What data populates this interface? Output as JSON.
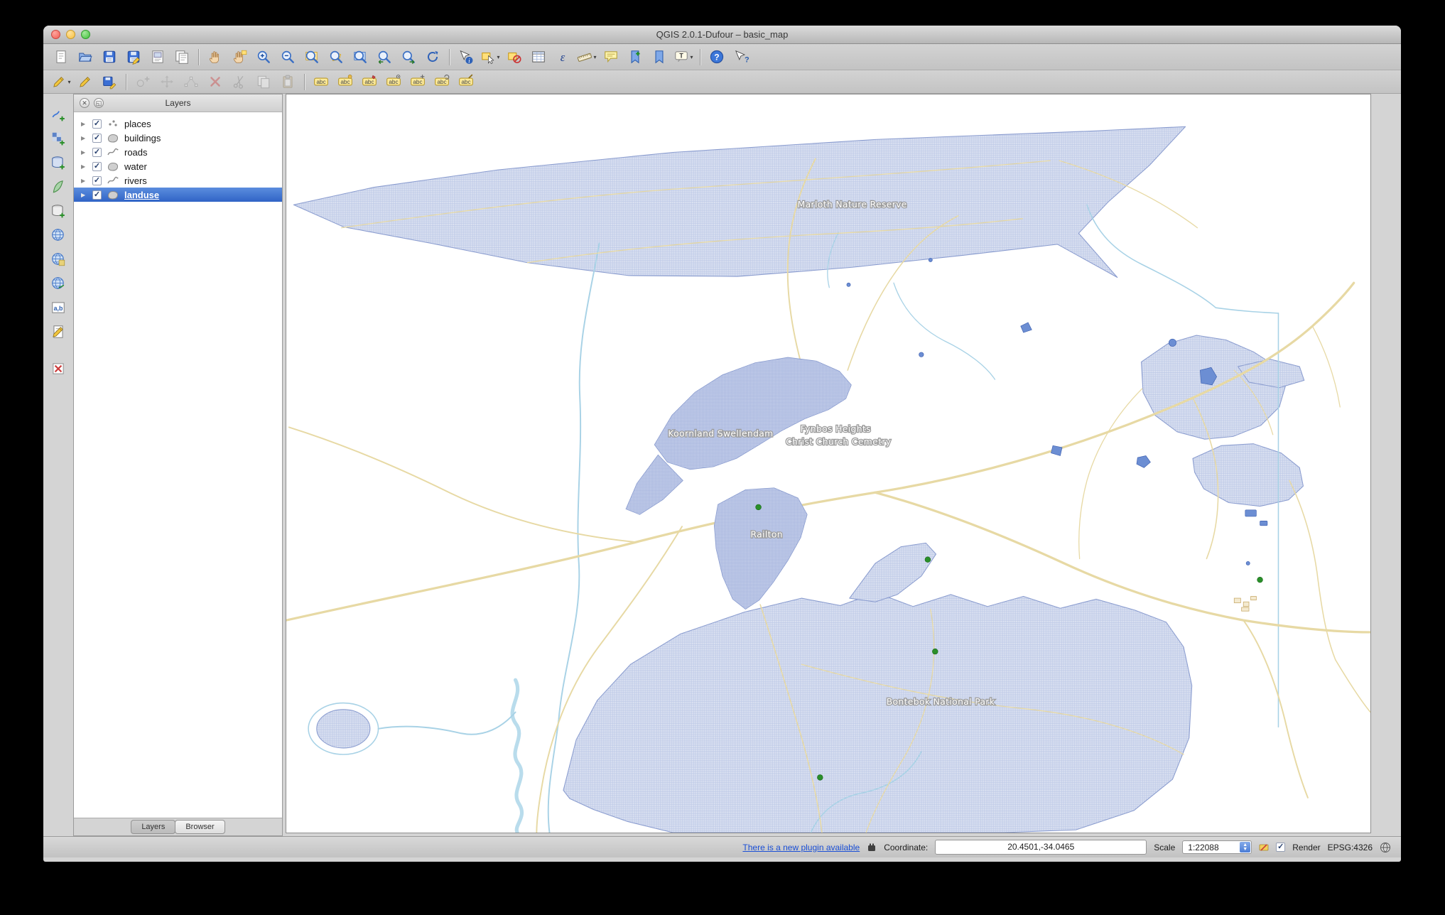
{
  "window": {
    "title": "QGIS 2.0.1-Dufour – basic_map"
  },
  "toolbar_main": {
    "icons": [
      {
        "name": "new-project"
      },
      {
        "name": "open-project"
      },
      {
        "name": "save-project"
      },
      {
        "name": "save-project-as"
      },
      {
        "name": "new-print-composer"
      },
      {
        "name": "composer-manager"
      },
      {
        "sep": true
      },
      {
        "name": "pan-map"
      },
      {
        "name": "pan-to-selection"
      },
      {
        "name": "zoom-in"
      },
      {
        "name": "zoom-out"
      },
      {
        "name": "zoom-full"
      },
      {
        "name": "zoom-to-selection"
      },
      {
        "name": "zoom-to-layer"
      },
      {
        "name": "zoom-last"
      },
      {
        "name": "zoom-next"
      },
      {
        "name": "refresh-map"
      },
      {
        "sep": true
      },
      {
        "name": "identify-features"
      },
      {
        "name": "select-features",
        "caret": true
      },
      {
        "name": "deselect-features"
      },
      {
        "name": "open-attribute-table"
      },
      {
        "name": "field-calculator"
      },
      {
        "name": "measure",
        "caret": true
      },
      {
        "name": "map-tips"
      },
      {
        "name": "new-bookmark"
      },
      {
        "name": "show-bookmarks"
      },
      {
        "name": "text-annotation",
        "caret": true
      },
      {
        "sep": true
      },
      {
        "name": "help-contents"
      },
      {
        "name": "whats-this"
      }
    ]
  },
  "toolbar_edit": {
    "icons": [
      {
        "name": "current-edits",
        "caret": true
      },
      {
        "name": "toggle-editing"
      },
      {
        "name": "save-layer-edits"
      },
      {
        "sep": true
      },
      {
        "name": "add-feature",
        "disabled": true
      },
      {
        "name": "move-feature",
        "disabled": true
      },
      {
        "name": "node-tool",
        "disabled": true
      },
      {
        "name": "delete-selected",
        "disabled": true
      },
      {
        "name": "cut-features",
        "disabled": true
      },
      {
        "name": "copy-features",
        "disabled": true
      },
      {
        "name": "paste-features",
        "disabled": true
      },
      {
        "sep": true
      },
      {
        "name": "labeling"
      },
      {
        "name": "highlight-pinned-labels"
      },
      {
        "name": "pin-unpin-labels"
      },
      {
        "name": "show-hide-labels"
      },
      {
        "name": "move-label"
      },
      {
        "name": "rotate-label"
      },
      {
        "name": "change-label-properties"
      }
    ]
  },
  "left_toolbar": {
    "icons": [
      {
        "name": "add-vector-layer"
      },
      {
        "name": "add-raster-layer"
      },
      {
        "name": "add-postgis-layer"
      },
      {
        "name": "add-spatialite-layer"
      },
      {
        "name": "add-mssql-layer"
      },
      {
        "name": "add-wms-layer"
      },
      {
        "name": "add-wcs-layer"
      },
      {
        "name": "add-wfs-layer"
      },
      {
        "name": "add-delimited-text-layer"
      },
      {
        "name": "new-shapefile-layer"
      },
      {
        "gap": true
      },
      {
        "name": "remove-layer"
      }
    ]
  },
  "layers_panel": {
    "title": "Layers",
    "items": [
      {
        "label": "places",
        "type": "point",
        "checked": true,
        "selected": false
      },
      {
        "label": "buildings",
        "type": "polygon",
        "checked": true,
        "selected": false
      },
      {
        "label": "roads",
        "type": "line",
        "checked": true,
        "selected": false
      },
      {
        "label": "water",
        "type": "polygon",
        "checked": true,
        "selected": false
      },
      {
        "label": "rivers",
        "type": "line",
        "checked": true,
        "selected": false
      },
      {
        "label": "landuse",
        "type": "polygon",
        "checked": true,
        "selected": true
      }
    ],
    "tabs": [
      {
        "label": "Layers",
        "active": true
      },
      {
        "label": "Browser",
        "active": false
      }
    ]
  },
  "map": {
    "labels": [
      {
        "text": "Marloth Nature Reserve"
      },
      {
        "text": "Koornland Swellendam"
      },
      {
        "text": "Fynbos Heights"
      },
      {
        "text": "Christ Church Cemetry"
      },
      {
        "text": "Railton"
      },
      {
        "text": "Bontebok National Park"
      }
    ],
    "colors": {
      "landuse_fill": "#e2e7f4",
      "landuse_border": "#8a9ccf",
      "urban_line": "#a3b2dd",
      "road": "#e7d9a4",
      "river": "#a8d2e6",
      "water": "#6c8ed3",
      "place_dot": "#2a8f2a"
    }
  },
  "statusbar": {
    "plugin_link": "There is a new plugin available",
    "coordinate_label": "Coordinate:",
    "coordinate_value": "20.4501,-34.0465",
    "scale_label": "Scale",
    "scale_value": "1:22088",
    "render_label": "Render",
    "crs_label": "EPSG:4326"
  }
}
